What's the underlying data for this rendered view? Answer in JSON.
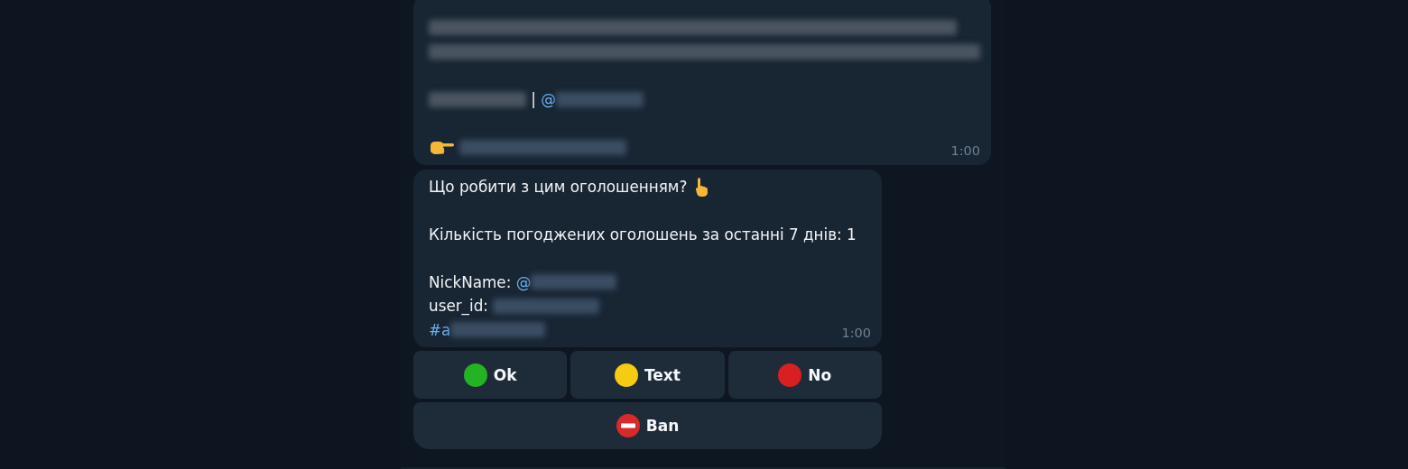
{
  "messages": [
    {
      "time": "1:00",
      "lines": [
        {
          "kind": "line",
          "parts": [
            {
              "kind": "redacted"
            }
          ]
        },
        {
          "kind": "line",
          "parts": [
            {
              "kind": "redacted"
            }
          ]
        },
        {
          "kind": "blank"
        },
        {
          "kind": "line",
          "parts": [
            {
              "kind": "redacted"
            },
            {
              "kind": "text",
              "text": " | "
            },
            {
              "kind": "link",
              "text": "@"
            },
            {
              "kind": "redacted-link"
            }
          ]
        },
        {
          "kind": "blank"
        },
        {
          "kind": "line",
          "parts": [
            {
              "kind": "hand-right"
            },
            {
              "kind": "redacted-link"
            }
          ]
        }
      ]
    },
    {
      "time": "1:00",
      "lines": [
        {
          "kind": "line",
          "parts": [
            {
              "kind": "text",
              "text": "Що робити з цим оголошенням? "
            },
            {
              "kind": "hand-up"
            }
          ]
        },
        {
          "kind": "blank"
        },
        {
          "kind": "line",
          "parts": [
            {
              "kind": "text",
              "text": "Кількість погоджених оголошень за останні 7 днів: 1"
            }
          ]
        },
        {
          "kind": "blank"
        },
        {
          "kind": "line",
          "parts": [
            {
              "kind": "text",
              "text": "NickName: "
            },
            {
              "kind": "link",
              "text": "@"
            },
            {
              "kind": "redacted-link"
            }
          ]
        },
        {
          "kind": "line",
          "parts": [
            {
              "kind": "text",
              "text": "user_id: "
            },
            {
              "kind": "redacted-link"
            }
          ]
        },
        {
          "kind": "line",
          "parts": [
            {
              "kind": "link",
              "text": "#a"
            },
            {
              "kind": "redacted-link"
            }
          ]
        }
      ]
    }
  ],
  "keyboard": [
    [
      {
        "label": "Ok",
        "kind": "dot",
        "color": "#22b422"
      },
      {
        "label": "Text",
        "kind": "dot",
        "color": "#f5cc12"
      },
      {
        "label": "No",
        "kind": "dot",
        "color": "#d91f1f"
      }
    ],
    [
      {
        "label": "Ban",
        "kind": "no-entry"
      }
    ]
  ]
}
